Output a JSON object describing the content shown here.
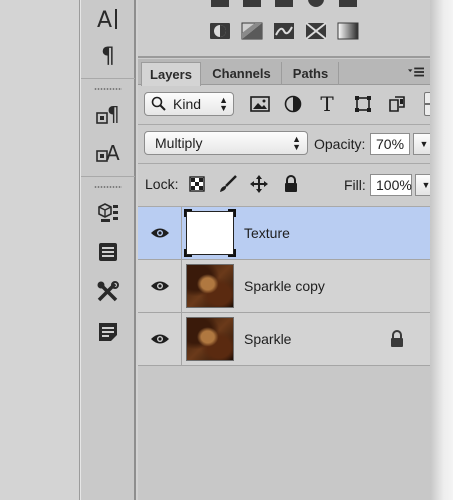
{
  "tool_strip": {
    "items": [
      {
        "name": "character-panel-icon",
        "glyph": "A|"
      },
      {
        "name": "paragraph-panel-icon",
        "glyph": "¶"
      },
      {
        "name": "paragraph-styles-icon",
        "glyph": "¶"
      },
      {
        "name": "character-styles-icon",
        "glyph": "A"
      },
      {
        "name": "3d-panel-icon",
        "glyph": ""
      },
      {
        "name": "properties-panel-icon",
        "glyph": ""
      },
      {
        "name": "tool-presets-icon",
        "glyph": ""
      },
      {
        "name": "notes-panel-icon",
        "glyph": ""
      }
    ]
  },
  "tabs": [
    {
      "label": "Layers",
      "active": true
    },
    {
      "label": "Channels",
      "active": false
    },
    {
      "label": "Paths",
      "active": false
    }
  ],
  "filter": {
    "kind_label": "Kind",
    "icons": [
      "pixel-layer-filter-icon",
      "adjustment-layer-filter-icon",
      "type-layer-filter-icon",
      "shape-layer-filter-icon",
      "smart-object-filter-icon"
    ],
    "type_glyph": "T"
  },
  "blend": {
    "mode": "Multiply",
    "opacity_label": "Opacity:",
    "opacity_value": "70%"
  },
  "lock": {
    "label": "Lock:",
    "fill_label": "Fill:",
    "fill_value": "100%"
  },
  "layers": [
    {
      "name": "Texture",
      "thumb": "white",
      "selected": true,
      "locked": false
    },
    {
      "name": "Sparkle copy",
      "thumb": "photo",
      "selected": false,
      "locked": false
    },
    {
      "name": "Sparkle",
      "thumb": "photo",
      "selected": false,
      "locked": true
    }
  ],
  "colors": {
    "selection": "#b9cdf2",
    "panel": "#cdcdcd"
  }
}
